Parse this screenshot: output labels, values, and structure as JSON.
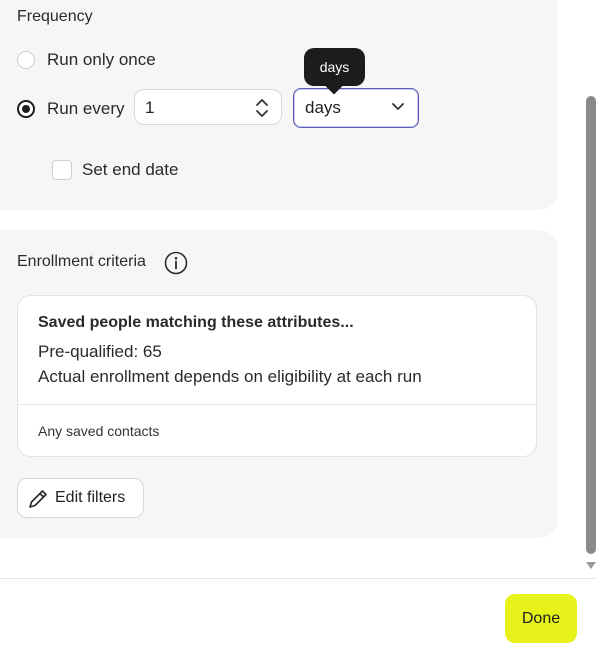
{
  "frequency": {
    "title": "Frequency",
    "run_once_label": "Run only once",
    "run_every_label": "Run every",
    "interval_value": "1",
    "unit_selected": "days",
    "unit_tooltip": "days",
    "set_end_date_label": "Set end date",
    "selected_option": "run_every"
  },
  "enrollment": {
    "title": "Enrollment criteria",
    "box_heading": "Saved people matching these attributes...",
    "prequalified": "Pre-qualified: 65",
    "note": "Actual enrollment depends on eligibility at each run",
    "filter_summary": "Any saved contacts",
    "edit_filters_label": "Edit filters"
  },
  "footer": {
    "done_label": "Done"
  },
  "colors": {
    "accent": "#e6f21a",
    "select_border": "#5b5bb5",
    "card_bg": "#f6f6f6"
  },
  "icons": {
    "info": "info-icon",
    "pencil": "pencil-icon",
    "chevron": "chevron-down-icon",
    "stepper": "stepper-icon"
  }
}
